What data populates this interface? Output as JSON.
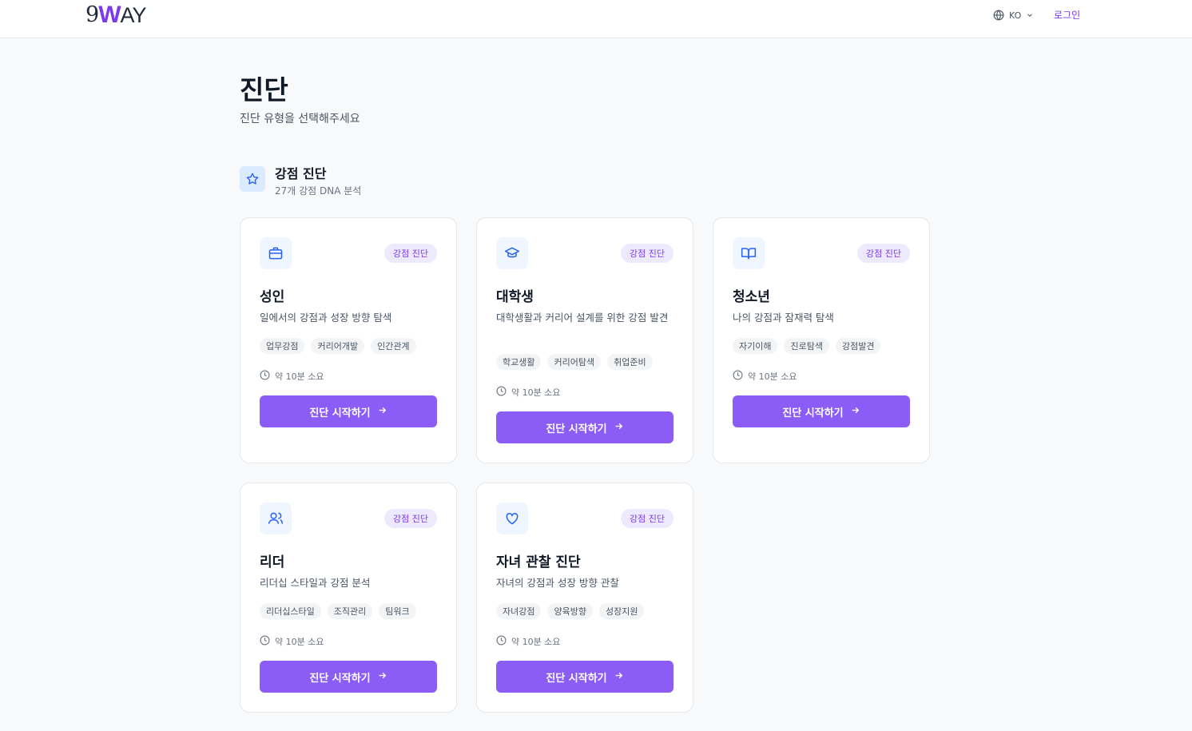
{
  "header": {
    "logo": {
      "prefix": "9",
      "w": "W",
      "suffix": "AY"
    },
    "language": "KO",
    "login_label": "로그인"
  },
  "page": {
    "title": "진단",
    "subtitle": "진단 유형을 선택해주세요"
  },
  "section": {
    "title": "강점 진단",
    "subtitle": "27개 강점 DNA 분석"
  },
  "cards": [
    {
      "icon": "briefcase-icon",
      "badge": "강점 진단",
      "title": "성인",
      "desc": "일에서의 강점과 성장 방향 탐색",
      "tags": [
        "업무강점",
        "커리어개발",
        "인간관계"
      ],
      "time": "약 10분 소요",
      "button": "진단 시작하기"
    },
    {
      "icon": "graduation-cap-icon",
      "badge": "강점 진단",
      "title": "대학생",
      "desc": "대학생활과 커리어 설계를 위한 강점 발견",
      "tags": [
        "학교생활",
        "커리어탐색",
        "취업준비"
      ],
      "time": "약 10분 소요",
      "button": "진단 시작하기"
    },
    {
      "icon": "book-icon",
      "badge": "강점 진단",
      "title": "청소년",
      "desc": "나의 강점과 잠재력 탐색",
      "tags": [
        "자기이해",
        "진로탐색",
        "강점발견"
      ],
      "time": "약 10분 소요",
      "button": "진단 시작하기"
    },
    {
      "icon": "users-icon",
      "badge": "강점 진단",
      "title": "리더",
      "desc": "리더십 스타일과 강점 분석",
      "tags": [
        "리더십스타일",
        "조직관리",
        "팀워크"
      ],
      "time": "약 10분 소요",
      "button": "진단 시작하기"
    },
    {
      "icon": "heart-icon",
      "badge": "강점 진단",
      "title": "자녀 관찰 진단",
      "desc": "자녀의 강점과 성장 방향 관찰",
      "tags": [
        "자녀강점",
        "양육방향",
        "성장지원"
      ],
      "time": "약 10분 소요",
      "button": "진단 시작하기"
    }
  ],
  "colors": {
    "accent": "#8b5cf6",
    "brand": "#7c3aed",
    "icon_blue": "#2563eb"
  }
}
